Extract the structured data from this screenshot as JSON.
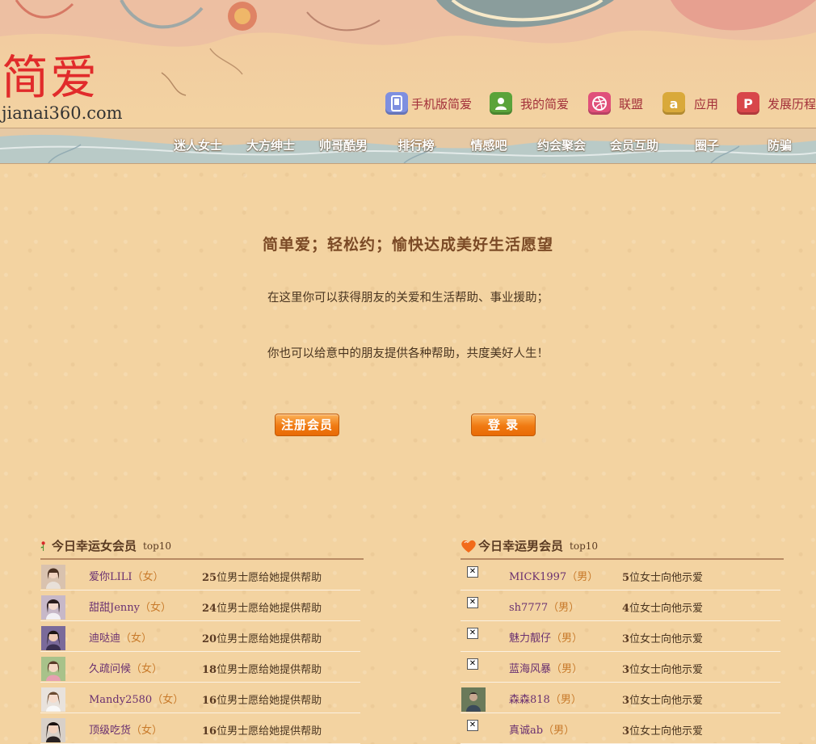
{
  "logo": {
    "cn": "简爱",
    "en": "jianai360.com"
  },
  "toplinks": [
    {
      "label": "手机版简爱",
      "icon": "mobile-icon",
      "color": "#7e8fe0"
    },
    {
      "label": "我的简爱",
      "icon": "user-icon",
      "color": "#5aa33a"
    },
    {
      "label": "联盟",
      "icon": "dribbble-icon",
      "color": "#e0507a"
    },
    {
      "label": "应用",
      "icon": "amazon-icon",
      "color": "#d9a93a"
    },
    {
      "label": "发展历程",
      "icon": "pinterest-icon",
      "color": "#d8464a"
    }
  ],
  "nav": [
    "迷人女士",
    "大方绅士",
    "帅哥酷男",
    "排行榜",
    "情感吧",
    "约会聚会",
    "会员互助",
    "圈子",
    "防骗"
  ],
  "intro": {
    "title": "简单爱；轻松约；愉快达成美好生活愿望",
    "line1": "在这里你可以获得朋友的关爱和生活帮助、事业援助；",
    "line2": "你也可以给意中的朋友提供各种帮助，共度美好人生！"
  },
  "buttons": {
    "register": "注册会员",
    "login": "登 录"
  },
  "female_panel": {
    "title": "今日幸运女会员",
    "sub": "top10",
    "rows": [
      {
        "name": "爱你LILI",
        "gender": "（女）",
        "count": "25",
        "suffix": "位男士愿给她提供帮助"
      },
      {
        "name": "甜甜Jenny",
        "gender": "（女）",
        "count": "24",
        "suffix": "位男士愿给她提供帮助"
      },
      {
        "name": "迪哒迪",
        "gender": "（女）",
        "count": "20",
        "suffix": "位男士愿给她提供帮助"
      },
      {
        "name": "久疏问候",
        "gender": "（女）",
        "count": "18",
        "suffix": "位男士愿给她提供帮助"
      },
      {
        "name": "Mandy2580",
        "gender": "（女）",
        "count": "16",
        "suffix": "位男士愿给她提供帮助"
      },
      {
        "name": "顶级吃货",
        "gender": "（女）",
        "count": "16",
        "suffix": "位男士愿给她提供帮助"
      }
    ]
  },
  "male_panel": {
    "title": "今日幸运男会员",
    "sub": "top10",
    "rows": [
      {
        "name": "MICK1997",
        "gender": "（男）",
        "count": "5",
        "suffix": "位女士向他示爱"
      },
      {
        "name": "sh7777",
        "gender": "（男）",
        "count": "4",
        "suffix": "位女士向他示爱"
      },
      {
        "name": "魅力靓仔",
        "gender": "（男）",
        "count": "3",
        "suffix": "位女士向他示爱"
      },
      {
        "name": "蓝海风暴",
        "gender": "（男）",
        "count": "3",
        "suffix": "位女士向他示爱"
      },
      {
        "name": "森森818",
        "gender": "（男）",
        "count": "3",
        "suffix": "位女士向他示爱"
      },
      {
        "name": "真诚ab",
        "gender": "（男）",
        "count": "3",
        "suffix": "位女士向他示爱"
      }
    ]
  }
}
